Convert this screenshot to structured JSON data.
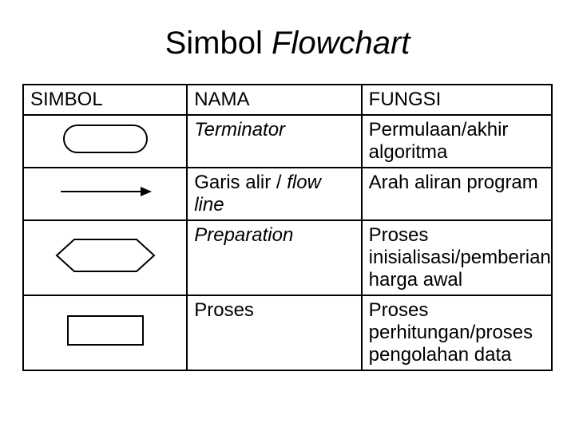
{
  "title": {
    "plain": "Simbol ",
    "italic": "Flowchart"
  },
  "headers": {
    "simbol": "SIMBOL",
    "nama": "NAMA",
    "fungsi": "FUNGSI"
  },
  "rows": [
    {
      "simbol_icon": "terminator",
      "nama_italic": "Terminator",
      "nama_plain": "",
      "fungsi": "Permulaan/akhir algoritma"
    },
    {
      "simbol_icon": "flowline",
      "nama_plain": "Garis alir / ",
      "nama_italic": "flow line",
      "fungsi": "Arah aliran program"
    },
    {
      "simbol_icon": "preparation",
      "nama_italic": "Preparation",
      "nama_plain": "",
      "fungsi": "Proses inisialisasi/pemberian harga awal"
    },
    {
      "simbol_icon": "process",
      "nama_plain": "Proses",
      "nama_italic": "",
      "fungsi": "Proses perhitungan/proses pengolahan data"
    }
  ]
}
